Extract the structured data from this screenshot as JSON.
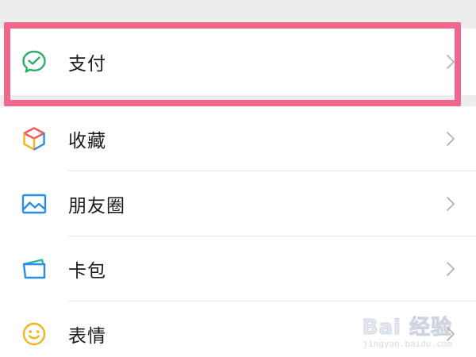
{
  "menu": {
    "pay": {
      "label": "支付",
      "icon": "wechat-pay-icon"
    },
    "items": [
      {
        "label": "收藏",
        "icon": "favorites-cube-icon"
      },
      {
        "label": "朋友圈",
        "icon": "moments-picture-icon"
      },
      {
        "label": "卡包",
        "icon": "card-wallet-icon"
      },
      {
        "label": "表情",
        "icon": "smiley-face-icon"
      }
    ]
  },
  "colors": {
    "pay_green": "#2aae67",
    "highlight": "#f0678e",
    "chevron": "#b2b2b2",
    "text": "#1a1a1a",
    "background": "#ededed"
  },
  "watermark": {
    "main": "Bai 经验",
    "sub": "jingyan.baidu.com"
  }
}
